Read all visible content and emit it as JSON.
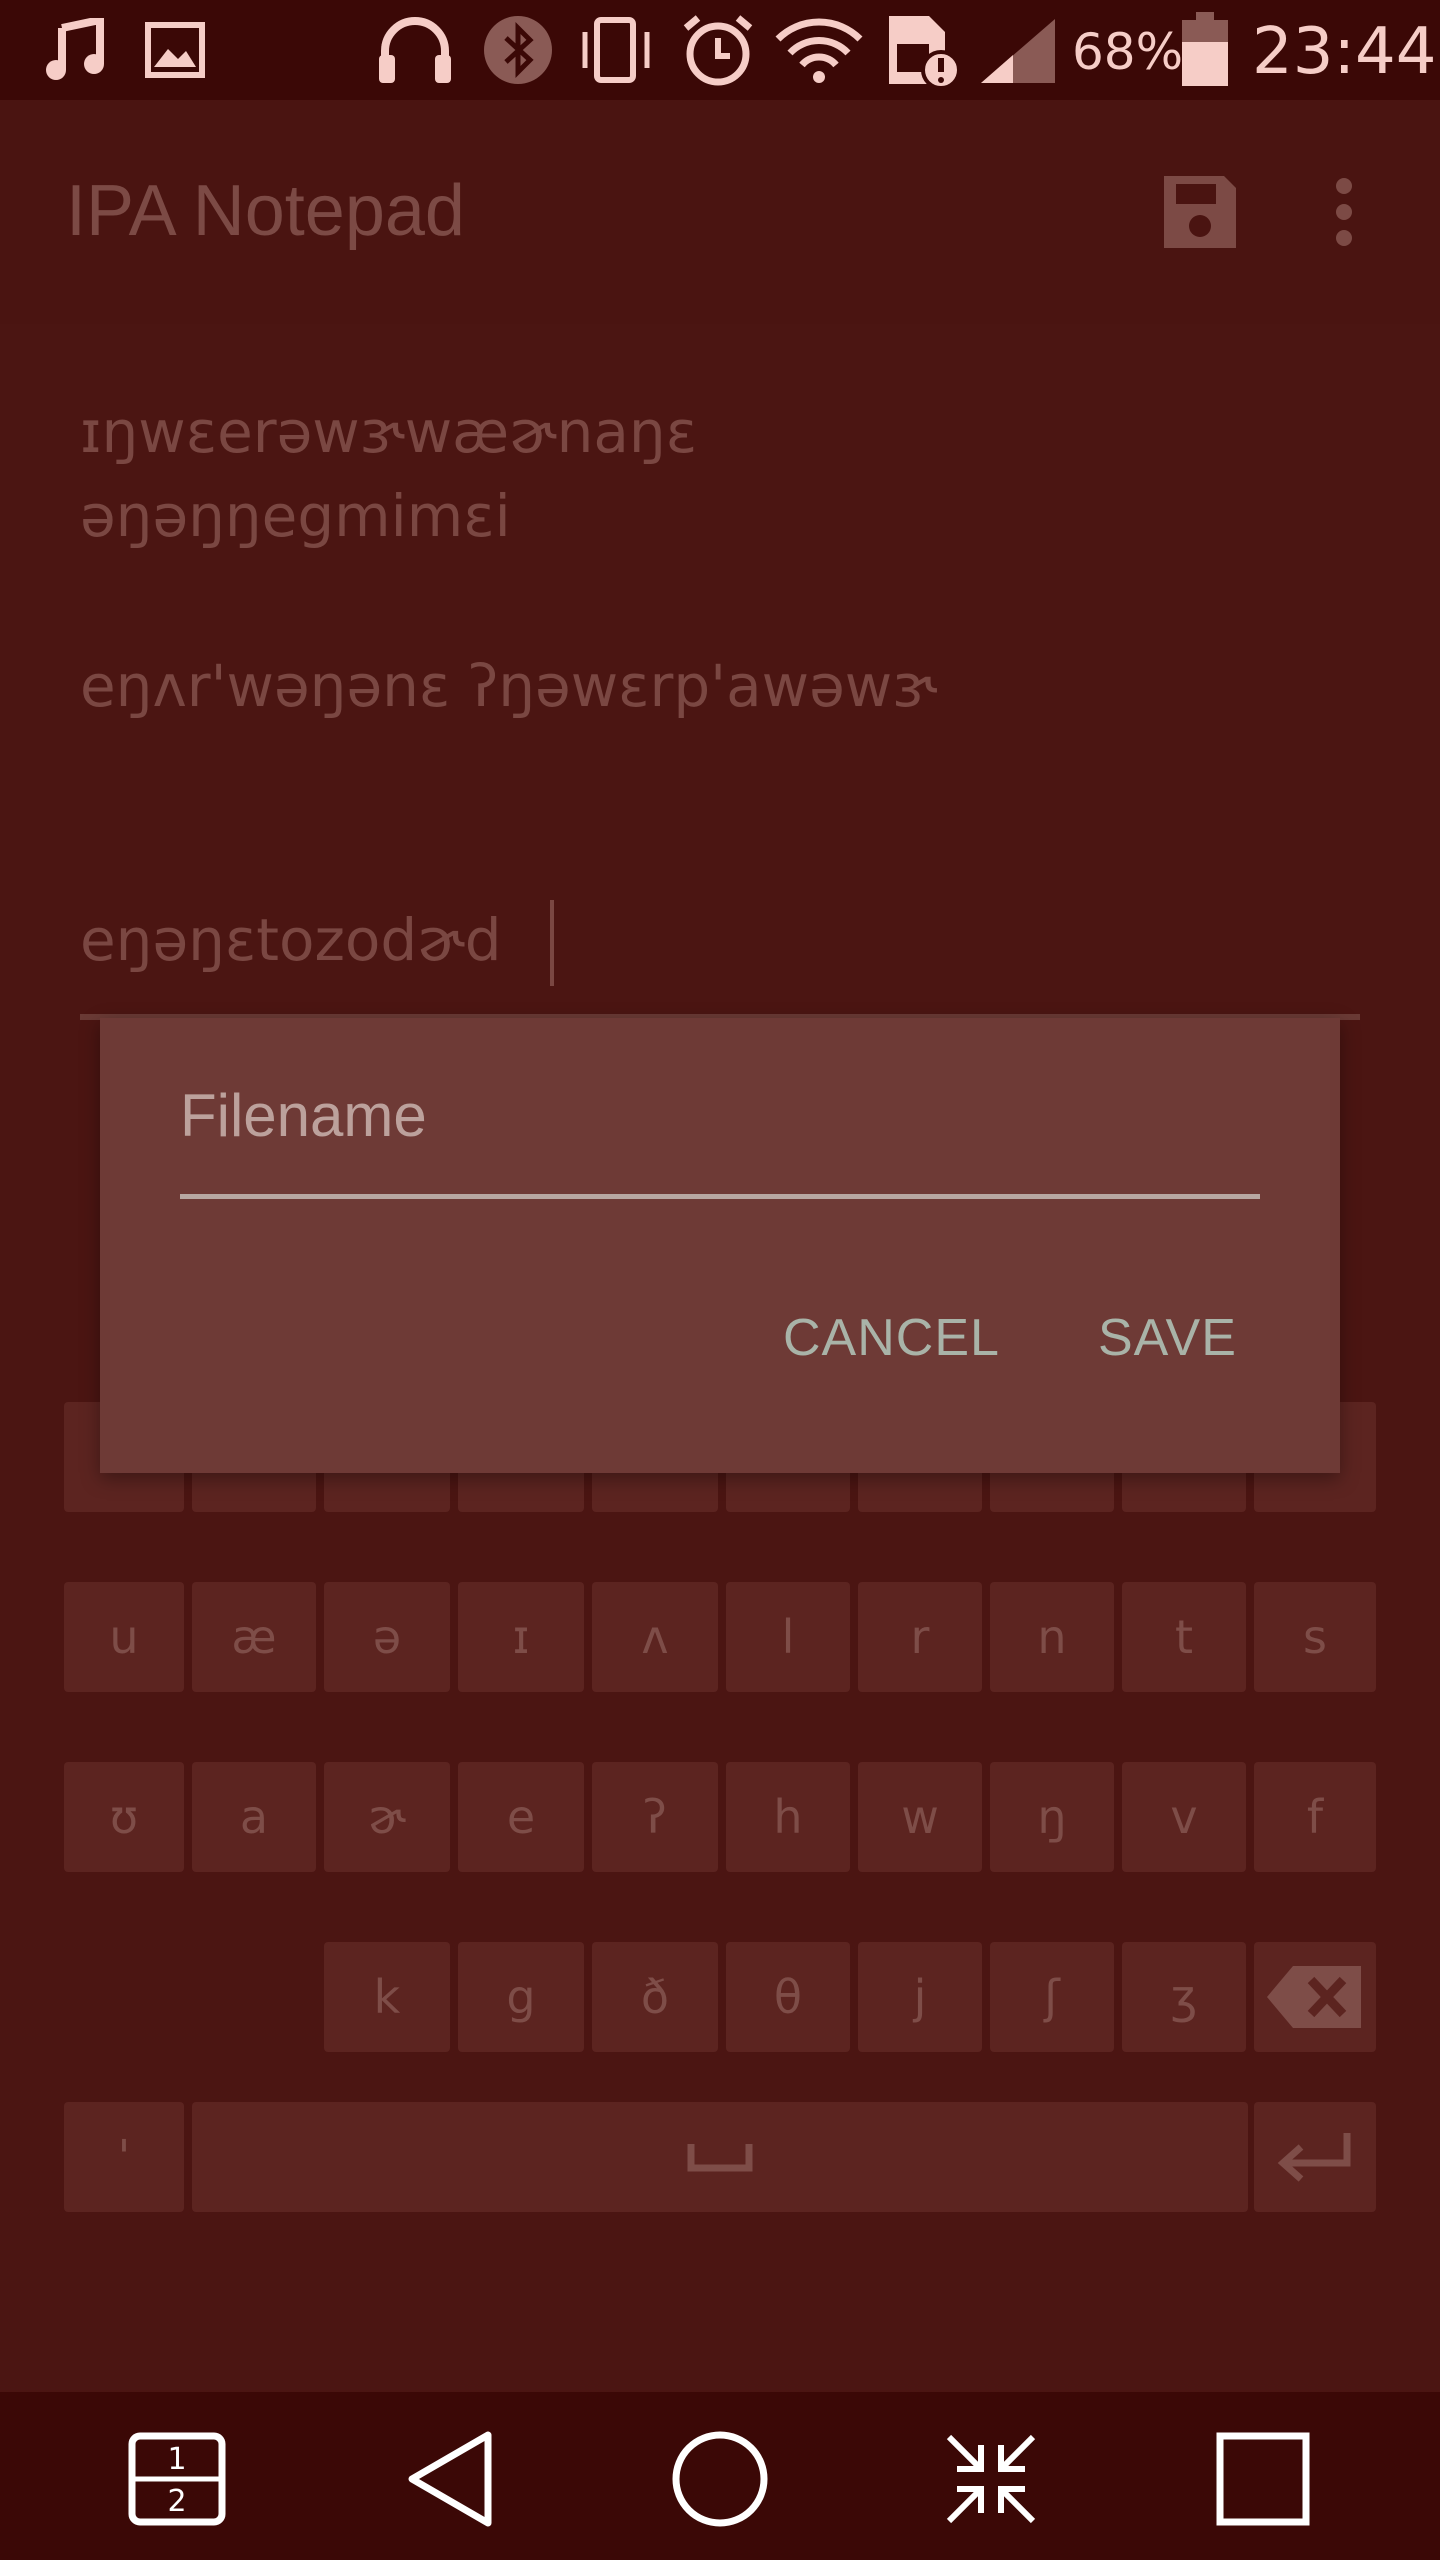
{
  "status_bar": {
    "icons": [
      "music-icon",
      "image-icon",
      "headphones-icon",
      "bluetooth-icon",
      "vibrate-icon",
      "alarm-icon",
      "wifi-icon",
      "sim-alert-icon",
      "signal-icon",
      "battery-icon"
    ],
    "battery_percent": "68%",
    "time": "23:44"
  },
  "app_bar": {
    "title": "IPA Notepad",
    "actions": [
      "save-icon",
      "more-vert-icon"
    ]
  },
  "editor": {
    "lines": [
      "ɪŋwɛerəwɝwæɚnaŋɛ",
      "əŋəŋŋegmimɛi",
      "eŋʌr'wəŋənɛ ʔŋəwɛrp'awəwɝ",
      "eŋəŋɛtozodɚd"
    ]
  },
  "dialog": {
    "filename_value": "",
    "filename_placeholder": "Filename",
    "cancel_label": "CANCEL",
    "save_label": "SAVE"
  },
  "keyboard": {
    "row1": [
      "u",
      "æ",
      "ə",
      "ɪ",
      "ʌ",
      "l",
      "r",
      "n",
      "t",
      "s"
    ],
    "row2": [
      "ʊ",
      "a",
      "ɚ",
      "e",
      "ʔ",
      "h",
      "w",
      "ŋ",
      "v",
      "f"
    ],
    "row3": [
      "k",
      "g",
      "ð",
      "θ",
      "j",
      "ʃ",
      "ʒ"
    ],
    "apostrophe": "'",
    "space": "␣"
  },
  "nav_bar": {
    "icons": [
      "dual-window-icon",
      "back-icon",
      "home-icon",
      "collapse-icon",
      "recents-icon"
    ],
    "dual_window_top": "1",
    "dual_window_bottom": "2"
  },
  "colors": {
    "status_bar_bg": "#3b0806",
    "app_bg": "#4b1512",
    "dialog_bg": "#6e3a36",
    "dialog_button": "#a9b3a8",
    "key_bg": "#5c2420"
  }
}
